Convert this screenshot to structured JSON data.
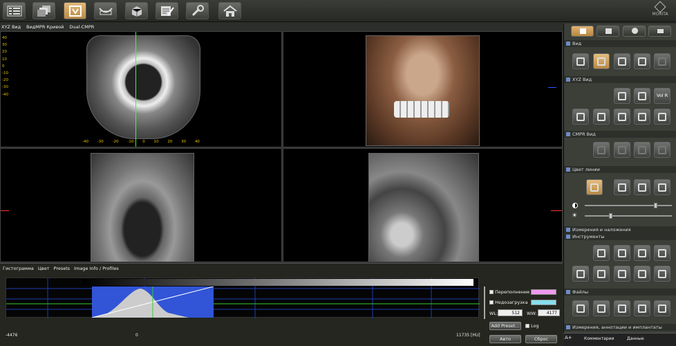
{
  "toolbar": {
    "buttons": [
      {
        "icon": "list-grid-icon",
        "active": false
      },
      {
        "icon": "stack-icon",
        "active": false
      },
      {
        "icon": "tooth-model-icon",
        "active": true
      },
      {
        "icon": "panoramic-icon",
        "active": false
      },
      {
        "icon": "cube-icon",
        "active": false
      },
      {
        "icon": "notes-icon",
        "active": false
      },
      {
        "icon": "wrench-icon",
        "active": false
      },
      {
        "icon": "home-icon",
        "active": false
      }
    ],
    "logo": "MORITA"
  },
  "view_tabs": [
    "XYZ Вид",
    "ВидMPR Кривой",
    "Dual-CMPR"
  ],
  "ruler_left": [
    "40",
    "30",
    "20",
    "10",
    "0",
    "-10",
    "-20",
    "-30",
    "-40"
  ],
  "ruler_bottom": [
    "-40",
    "-30",
    "-20",
    "-10",
    "0",
    "10",
    "20",
    "30",
    "40"
  ],
  "histogram": {
    "tabs": [
      "Гистограмма",
      "Цвет",
      "Presets",
      "Image Info / Profiles"
    ],
    "min_label": "-4476",
    "zero_label": "0",
    "max_label": "11735 [HU]",
    "overflow_label": "Переполнение",
    "underflow_label": "Недозагрузка",
    "wl_label": "WL:",
    "wl_value": "512",
    "ww_label": "WW:",
    "ww_value": "4177",
    "add_preset": "Add Preset...",
    "log_label": "Log",
    "auto_button": "Авто",
    "reset_button": "Сброс",
    "overflow_color": "#ee99ee",
    "underflow_color": "#88ddee"
  },
  "right_panel": {
    "tabs": [
      "view-icon",
      "tooth-icon",
      "info-icon",
      "tools-icon"
    ],
    "sections": {
      "view": "Вид",
      "xyz": "XYZ Вид",
      "cmpr": "CMPR Вид",
      "line_color": "Цвет линии",
      "measure": "Измерения и наложения",
      "tools": "Инструменты",
      "files": "Файлы",
      "annotations": "Измерения, аннотации и имплантаты"
    },
    "vol_r": "Vol R",
    "bottom_cols": [
      "Комментарии",
      "Данные"
    ],
    "bottom_left": "A+"
  }
}
